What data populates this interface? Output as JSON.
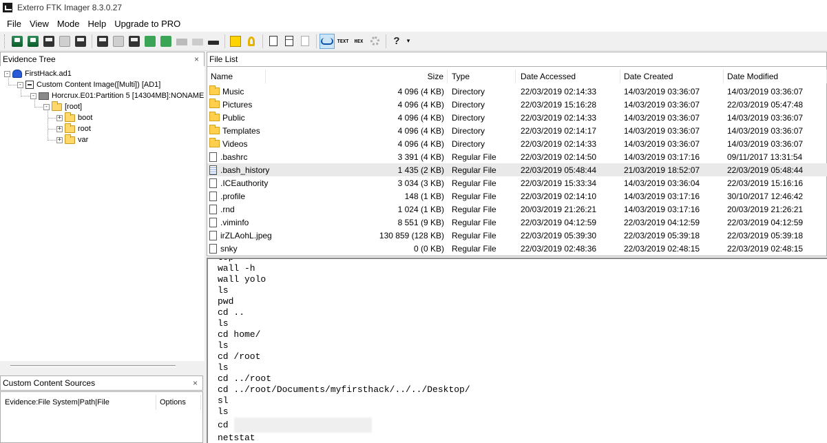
{
  "window": {
    "title": "Exterro FTK Imager 8.3.0.27"
  },
  "menu": [
    "File",
    "View",
    "Mode",
    "Help",
    "Upgrade to PRO"
  ],
  "toolbar": {
    "icons": [
      "add-evidence-icon",
      "add-all-evidence-icon",
      "image-mounting-icon",
      "remove-evidence-icon",
      "remove-all-evidence-icon",
      "create-disk-image-icon",
      "export-disk-image-icon",
      "export-logical-image-icon",
      "add-to-custom-content-icon",
      "create-custom-content-image-icon",
      "decrypt-icon",
      "verify-drive-icon",
      "capture-memory-icon",
      "obtain-protected-files-icon",
      "detect-encryption-icon",
      "export-files-icon",
      "export-file-hash-list-icon",
      "export-directory-listing-icon",
      "auto-view-icon",
      "text-view-icon",
      "hex-view-icon",
      "video-thumbnails-icon",
      "help-icon"
    ],
    "text_label": "TEXT",
    "hex_label": "HEX"
  },
  "evidence_tree": {
    "title": "Evidence Tree",
    "close": "×",
    "nodes": [
      "FirstHack.ad1",
      "Custom Content Image([Multi]) [AD1]",
      "Horcrux.E01:Partition 5 [14304MB]:NONAME",
      "[root]",
      "boot",
      "root",
      "var"
    ],
    "expand": "-",
    "collapse_plus": "+"
  },
  "custom_content": {
    "title": "Custom Content Sources",
    "close": "×",
    "col_evidence": "Evidence:File System|Path|File",
    "col_options": "Options"
  },
  "file_list": {
    "title": "File List",
    "columns": [
      "Name",
      "Size",
      "Type",
      "Date Accessed",
      "Date Created",
      "Date Modified"
    ],
    "rows": [
      {
        "name": "Music",
        "size": "4 096 (4 KB)",
        "type": "Directory",
        "accessed": "22/03/2019 02:14:33",
        "created": "14/03/2019 03:36:07",
        "modified": "14/03/2019 03:36:07",
        "icon": "folder"
      },
      {
        "name": "Pictures",
        "size": "4 096 (4 KB)",
        "type": "Directory",
        "accessed": "22/03/2019 15:16:28",
        "created": "14/03/2019 03:36:07",
        "modified": "22/03/2019 05:47:48",
        "icon": "folder"
      },
      {
        "name": "Public",
        "size": "4 096 (4 KB)",
        "type": "Directory",
        "accessed": "22/03/2019 02:14:33",
        "created": "14/03/2019 03:36:07",
        "modified": "14/03/2019 03:36:07",
        "icon": "folder"
      },
      {
        "name": "Templates",
        "size": "4 096 (4 KB)",
        "type": "Directory",
        "accessed": "22/03/2019 02:14:17",
        "created": "14/03/2019 03:36:07",
        "modified": "14/03/2019 03:36:07",
        "icon": "folder"
      },
      {
        "name": "Videos",
        "size": "4 096 (4 KB)",
        "type": "Directory",
        "accessed": "22/03/2019 02:14:33",
        "created": "14/03/2019 03:36:07",
        "modified": "14/03/2019 03:36:07",
        "icon": "folder"
      },
      {
        "name": ".bashrc",
        "size": "3 391 (4 KB)",
        "type": "Regular File",
        "accessed": "22/03/2019 02:14:50",
        "created": "14/03/2019 03:17:16",
        "modified": "09/11/2017 13:31:54",
        "icon": "file"
      },
      {
        "name": ".bash_history",
        "size": "1 435 (2 KB)",
        "type": "Regular File",
        "accessed": "22/03/2019 05:48:44",
        "created": "21/03/2019 18:52:07",
        "modified": "22/03/2019 05:48:44",
        "icon": "text"
      },
      {
        "name": ".ICEauthority",
        "size": "3 034 (3 KB)",
        "type": "Regular File",
        "accessed": "22/03/2019 15:33:34",
        "created": "14/03/2019 03:36:04",
        "modified": "22/03/2019 15:16:16",
        "icon": "file"
      },
      {
        "name": ".profile",
        "size": "148 (1 KB)",
        "type": "Regular File",
        "accessed": "22/03/2019 02:14:10",
        "created": "14/03/2019 03:17:16",
        "modified": "30/10/2017 12:46:42",
        "icon": "file"
      },
      {
        "name": ".rnd",
        "size": "1 024 (1 KB)",
        "type": "Regular File",
        "accessed": "20/03/2019 21:26:21",
        "created": "14/03/2019 03:17:16",
        "modified": "20/03/2019 21:26:21",
        "icon": "file"
      },
      {
        "name": ".viminfo",
        "size": "8 551 (9 KB)",
        "type": "Regular File",
        "accessed": "22/03/2019 04:12:59",
        "created": "22/03/2019 04:12:59",
        "modified": "22/03/2019 04:12:59",
        "icon": "file"
      },
      {
        "name": "irZLAohL.jpeg",
        "size": "130 859 (128 KB)",
        "type": "Regular File",
        "accessed": "22/03/2019 05:39:30",
        "created": "22/03/2019 05:39:18",
        "modified": "22/03/2019 05:39:18",
        "icon": "file"
      },
      {
        "name": "snky",
        "size": "0 (0 KB)",
        "type": "Regular File",
        "accessed": "22/03/2019 02:48:36",
        "created": "22/03/2019 02:48:15",
        "modified": "22/03/2019 02:48:15",
        "icon": "file"
      }
    ]
  },
  "viewer": {
    "lines": [
      "top",
      "wall -h",
      "wall yolo",
      "ls",
      "pwd",
      "cd ..",
      "ls",
      "cd home/",
      "ls",
      "cd /root",
      "ls",
      "cd ../root",
      "cd ../root/Documents/myfirsthack/../../Desktop/",
      "sl",
      "ls",
      "cd",
      "netstat"
    ]
  }
}
